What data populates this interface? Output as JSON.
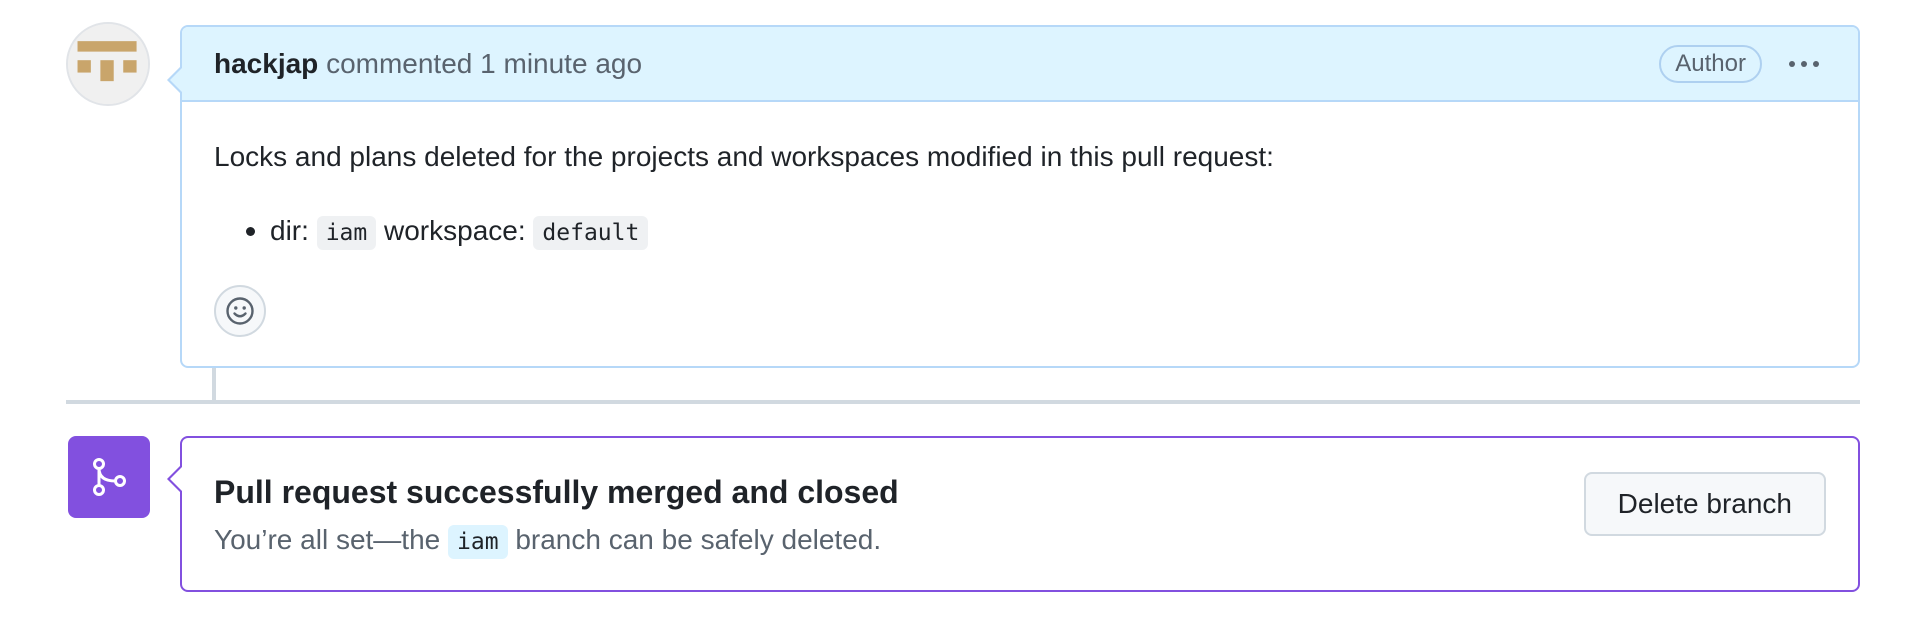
{
  "comment": {
    "author": "hackjap",
    "action_text": "commented",
    "timestamp": "1 minute ago",
    "badge": "Author",
    "avatar_icon": "identicon-avatar",
    "menu_icon": "kebab-horizontal-icon",
    "reaction_icon": "smiley-icon",
    "body_text": "Locks and plans deleted for the projects and workspaces modified in this pull request:",
    "list_items": [
      {
        "dir_label": "dir:",
        "dir_value": "iam",
        "workspace_label": "workspace:",
        "workspace_value": "default"
      }
    ]
  },
  "merged": {
    "icon": "git-merge-icon",
    "title": "Pull request successfully merged and closed",
    "subtitle_prefix": "You’re all set—the",
    "branch_name": "iam",
    "subtitle_suffix": "branch can be safely deleted.",
    "delete_button_label": "Delete branch"
  },
  "colors": {
    "header_bg": "#ddf4ff",
    "header_border": "#b6d8f8",
    "merged_purple": "#8250df",
    "avatar_tan": "#c9a56b",
    "muted_text": "#59636e"
  }
}
